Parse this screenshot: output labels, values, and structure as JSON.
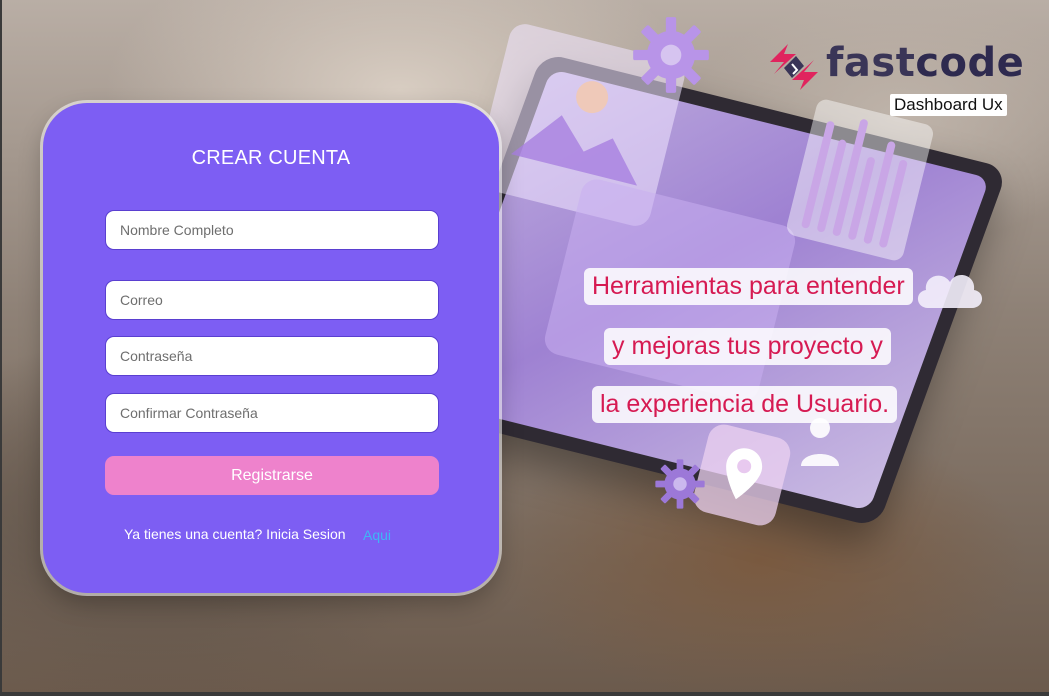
{
  "form": {
    "title": "CREAR CUENTA",
    "fields": [
      {
        "placeholder": "Nombre Completo",
        "value": ""
      },
      {
        "placeholder": "Correo",
        "value": ""
      },
      {
        "placeholder": "Contraseña",
        "value": ""
      },
      {
        "placeholder": "Confirmar Contraseña",
        "value": ""
      }
    ],
    "submit_label": "Registrarse",
    "login_prompt": "Ya tienes una cuenta? Inicia Sesion",
    "login_link": "Aqui"
  },
  "brand": {
    "name_part1": "fast",
    "name_part2": "code",
    "subtitle": "Dashboard Ux",
    "logo_icon": "fastcode-logo-icon"
  },
  "tagline": {
    "line1": "Herramientas para entender",
    "line2": "y mejoras tus proyecto y",
    "line3": "la experiencia de Usuario."
  },
  "colors": {
    "form_bg": "#7d5ef3",
    "button_bg": "#ee82cc",
    "link": "#3fb6f5",
    "tagline_text": "#d61a52",
    "logo_red": "#e0245e",
    "logo_dark": "#3a3557"
  }
}
